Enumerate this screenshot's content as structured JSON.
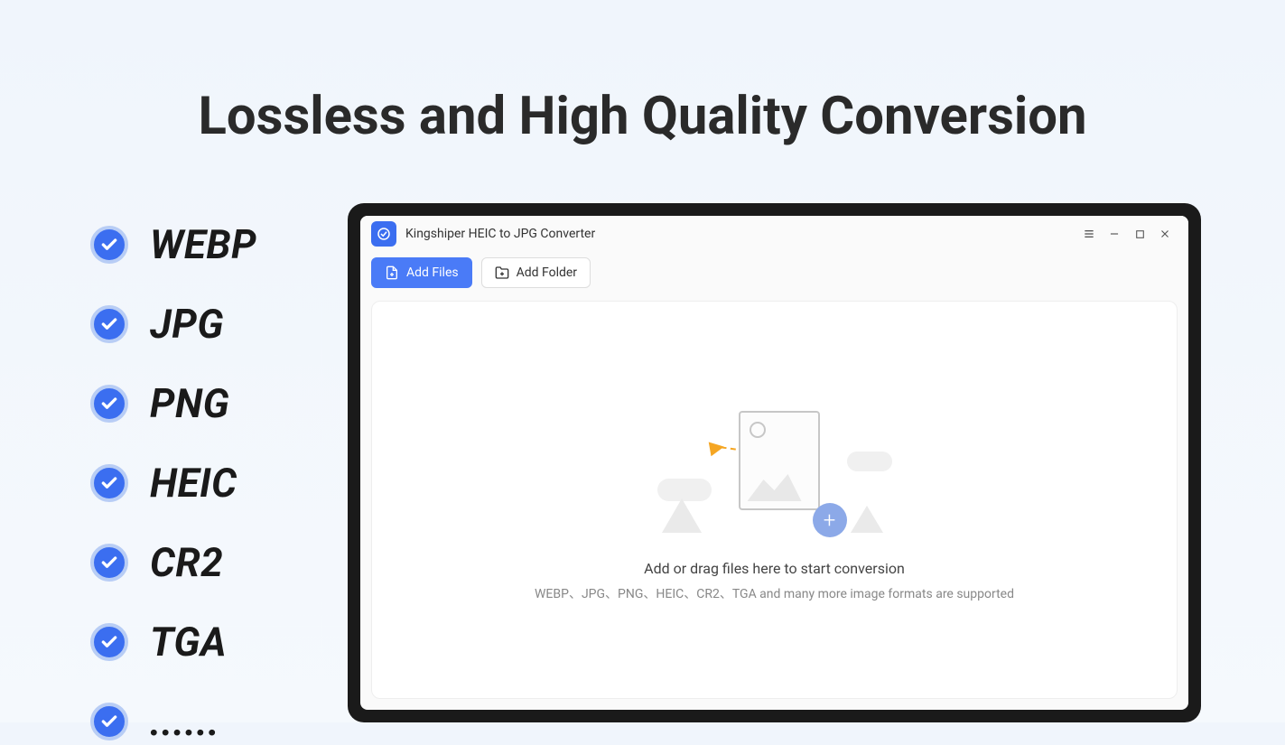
{
  "headline": "Lossless and High Quality Conversion",
  "formats": [
    "WEBP",
    "JPG",
    "PNG",
    "HEIC",
    "CR2",
    "TGA",
    "......"
  ],
  "app": {
    "title": "Kingshiper HEIC to JPG Converter",
    "toolbar": {
      "add_files": "Add Files",
      "add_folder": "Add Folder"
    },
    "drop": {
      "main": "Add or drag  files here to start conversion",
      "sub": "WEBP、JPG、PNG、HEIC、CR2、TGA and many more image formats are supported"
    }
  }
}
